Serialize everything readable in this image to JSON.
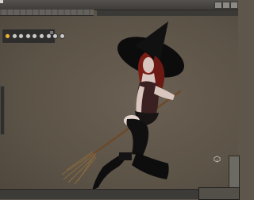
{
  "window": {
    "title": ""
  },
  "toolbar": {
    "buttons": [
      {
        "icon": "active-tool-icon",
        "active": true
      },
      {
        "icon": "tool-icon",
        "active": false
      },
      {
        "icon": "tool-icon",
        "active": false
      },
      {
        "icon": "tool-icon",
        "active": false
      },
      {
        "icon": "tool-icon",
        "active": false
      },
      {
        "icon": "tool-icon",
        "active": false
      },
      {
        "icon": "tool-icon",
        "active": false
      },
      {
        "icon": "tool-icon",
        "active": false
      },
      {
        "icon": "tool-icon",
        "active": false
      }
    ]
  },
  "scene": {
    "subject": "witch-avatar-on-broom",
    "colors": {
      "background": "#5f564b",
      "hat": "#0d0c0c",
      "hair": "#7b1d14",
      "accent": "#f0b02a"
    }
  }
}
